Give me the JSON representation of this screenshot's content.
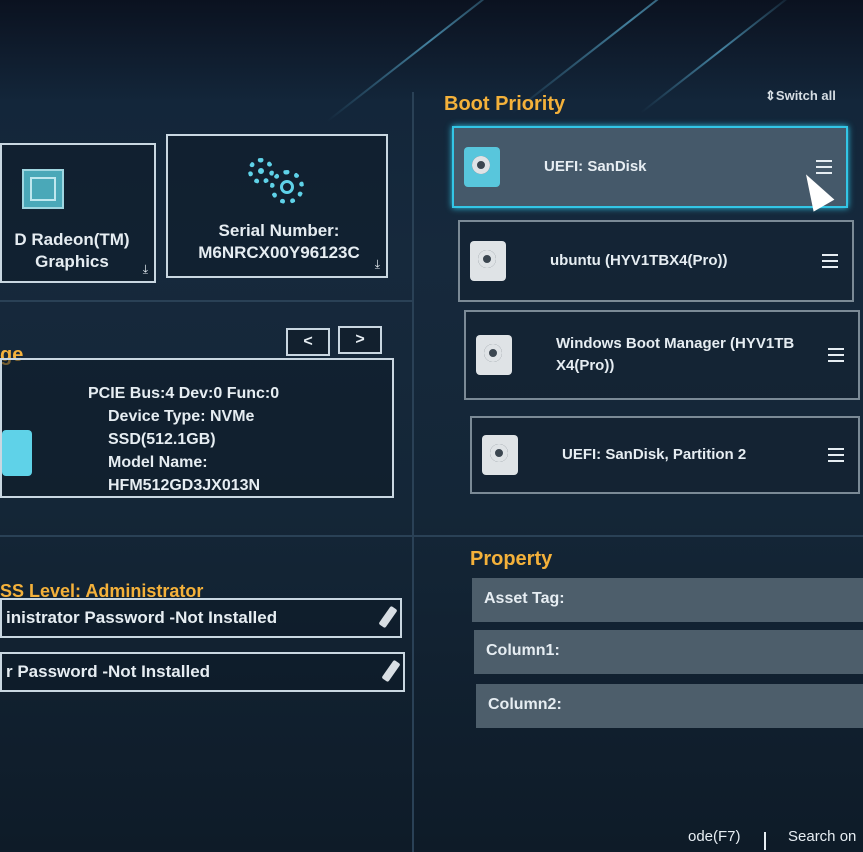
{
  "cards": {
    "graphics": {
      "line1": "D Radeon(TM)",
      "line2": "Graphics"
    },
    "serial": {
      "line1": "Serial Number:",
      "line2": "M6NRCX00Y96123C"
    }
  },
  "storage": {
    "title_fragment": "ge",
    "prev_label": "<",
    "next_label": ">",
    "lines": [
      "PCIE Bus:4 Dev:0 Func:0",
      "Device Type: NVMe",
      "SSD(512.1GB)",
      "Model Name:",
      "HFM512GD3JX013N"
    ]
  },
  "security": {
    "level": "SS Level: Administrator",
    "admin_password": "inistrator Password -Not Installed",
    "user_password": "r Password -Not Installed"
  },
  "boot": {
    "title": "Boot Priority",
    "switch_all": "Switch all",
    "items": [
      {
        "label": "UEFI: SanDisk",
        "selected": true
      },
      {
        "label": "ubuntu (HYV1TBX4(Pro))",
        "selected": false
      },
      {
        "label": "Windows Boot Manager (HYV1TB X4(Pro))",
        "selected": false
      },
      {
        "label": "UEFI: SanDisk, Partition 2",
        "selected": false
      }
    ]
  },
  "property": {
    "title": "Property",
    "fields": [
      {
        "label": "Asset Tag:"
      },
      {
        "label": "Column1:"
      },
      {
        "label": "Column2:"
      }
    ]
  },
  "footer": {
    "left_fragment": "ode(F7)",
    "search": "Search on"
  },
  "colors": {
    "accent": "#f4b13a",
    "selected_border": "#33c6e6",
    "icon": "#5fd2e8"
  }
}
